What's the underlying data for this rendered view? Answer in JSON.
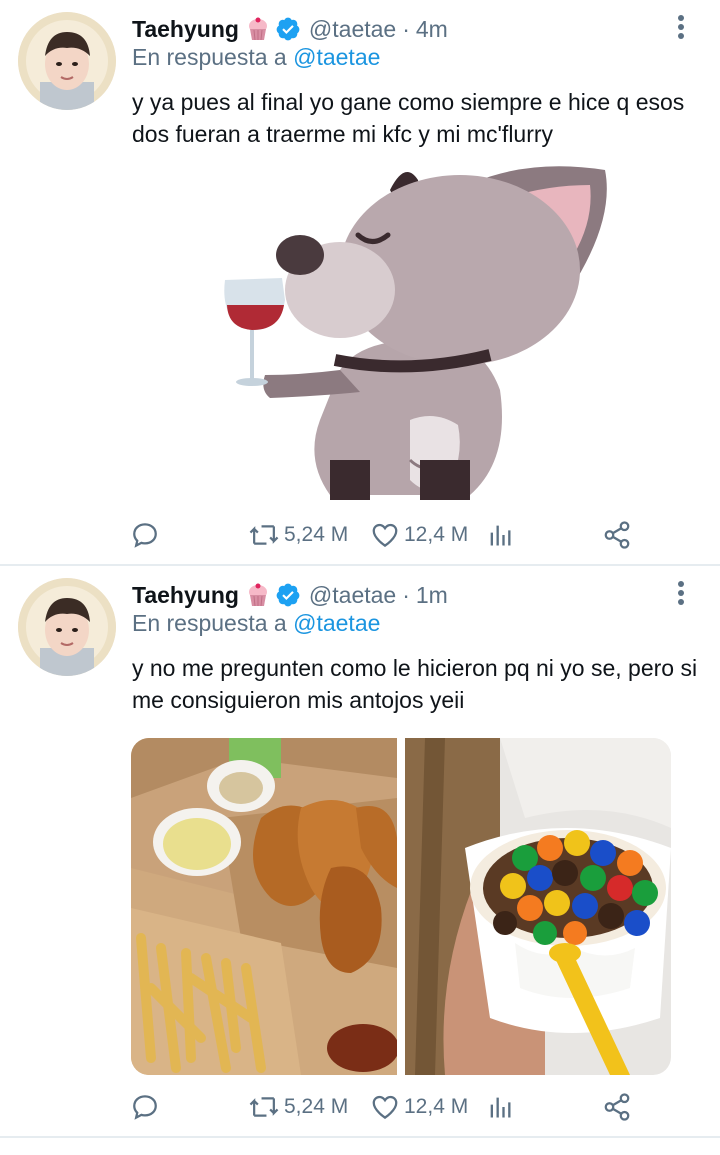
{
  "tweets": [
    {
      "author": {
        "name": "Taehyung",
        "handle": "@taetae",
        "emoji": "cupcake-emoji",
        "verified": true
      },
      "time": "4m",
      "reply_prefix": "En respuesta a",
      "reply_to": "@taetae",
      "text": "y ya pues al final yo gane como siempre e hice q esos dos fueran a traerme mi kfc y mi mc'flurry",
      "media": [
        "cartoon-dog-drinking-wine-sticker"
      ],
      "stats": {
        "retweets": "5,24 M",
        "likes": "12,4 M"
      }
    },
    {
      "author": {
        "name": "Taehyung",
        "handle": "@taetae",
        "emoji": "cupcake-emoji",
        "verified": true
      },
      "time": "1m",
      "reply_prefix": "En respuesta a",
      "reply_to": "@taetae",
      "text": "y no me pregunten como le hicieron pq ni yo se, pero si me consiguieron mis antojos yeii",
      "media": [
        "fried-chicken-and-fries-photo",
        "mcflurry-mms-photo"
      ],
      "stats": {
        "retweets": "5,24 M",
        "likes": "12,4 M"
      }
    }
  ],
  "colors": {
    "secondary_text": "#5b7083",
    "link": "#1b95e0",
    "verified": "#1da1f2",
    "divider": "#e6ecf0"
  }
}
